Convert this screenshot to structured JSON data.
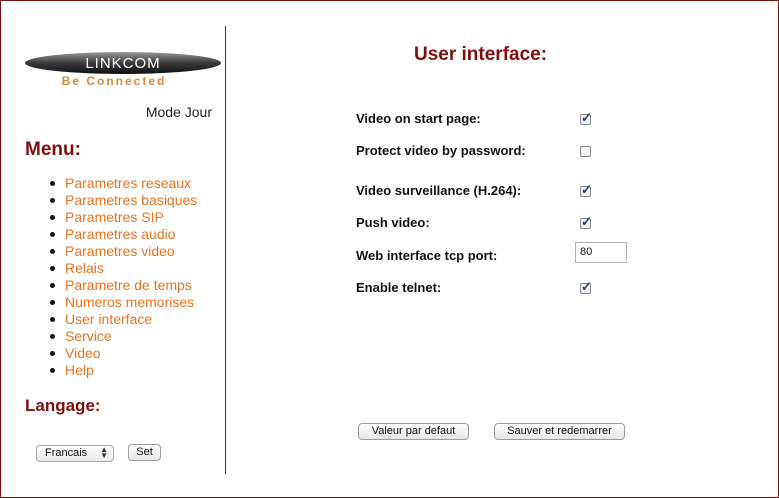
{
  "brand": {
    "logo_text": "LINKCOM",
    "tagline": "Be Connected"
  },
  "sidebar": {
    "mode_label": "Mode Jour",
    "menu_title": "Menu:",
    "menu_items": [
      {
        "label": "Parametres reseaux"
      },
      {
        "label": "Parametres basiques"
      },
      {
        "label": "Parametres SIP"
      },
      {
        "label": "Parametres audio"
      },
      {
        "label": "Parametres video"
      },
      {
        "label": "Relais"
      },
      {
        "label": "Parametre de temps"
      },
      {
        "label": "Numeros memorises"
      },
      {
        "label": "User interface"
      },
      {
        "label": "Service"
      },
      {
        "label": "Video"
      },
      {
        "label": "Help"
      }
    ],
    "language_title": "Langage:",
    "language_selected": "Francais",
    "set_label": "Set"
  },
  "main": {
    "title": "User interface:",
    "settings": [
      {
        "label": "Video on start page:",
        "type": "checkbox",
        "checked": true
      },
      {
        "label": "Protect video by password:",
        "type": "checkbox",
        "checked": false
      },
      {
        "label": "Video surveillance (H.264):",
        "type": "checkbox",
        "checked": true
      },
      {
        "label": "Push video:",
        "type": "checkbox",
        "checked": true
      },
      {
        "label": "Web interface tcp port:",
        "type": "text",
        "value": "80"
      },
      {
        "label": "Enable telnet:",
        "type": "checkbox",
        "checked": true
      }
    ],
    "default_button": "Valeur par defaut",
    "save_button": "Sauver et redemarrer"
  },
  "colors": {
    "heading": "#7f0f0f",
    "link": "#e8731e",
    "checkmark": "#1d3f86"
  }
}
